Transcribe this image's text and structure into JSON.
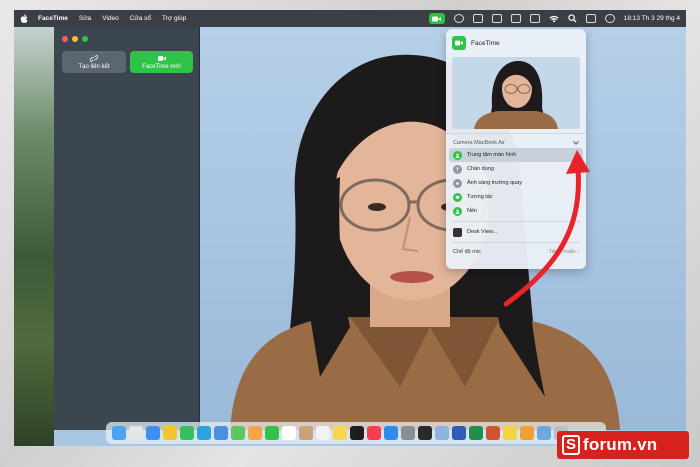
{
  "menubar": {
    "app": "FaceTime",
    "items": [
      "Sửa",
      "Video",
      "Cửa sổ",
      "Trợ giúp"
    ],
    "clock": "18:13 Th 3 29 thg 4"
  },
  "sidebar": {
    "link_button": "Tạo liên kết",
    "new_button": "FaceTime mới"
  },
  "dropdown": {
    "title": "FaceTime",
    "section": "Camera MacBook Air",
    "items": [
      {
        "label": "Trung tâm màn hình",
        "icon": "person-icon"
      },
      {
        "label": "Chân dung",
        "icon": "portrait-icon"
      },
      {
        "label": "Ánh sáng trường quay",
        "icon": "studio-light-icon"
      },
      {
        "label": "Tương tác",
        "icon": "reactions-icon"
      },
      {
        "label": "Nền",
        "icon": "background-icon"
      }
    ],
    "desk_view": "Desk View...",
    "mic_label": "Chế độ mic",
    "mic_value": "Tiêu chuẩn"
  },
  "brand": {
    "logo_letter": "S",
    "name": "forum.vn"
  },
  "colors": {
    "facetime_green": "#2fc447",
    "menubar": "#3a3f45",
    "sidebar": "#3b4650",
    "arrow": "#e8242a",
    "brand_red": "#d7211d"
  },
  "dock_icons": [
    "finder-icon",
    "launchpad-icon",
    "safari-icon",
    "chrome-icon",
    "messages-icon",
    "telegram-icon",
    "mail-icon",
    "maps-icon",
    "photos-icon",
    "facetime-icon",
    "calendar-icon",
    "contacts-icon",
    "reminders-icon",
    "notes-icon",
    "appletv-icon",
    "music-icon",
    "appstore-icon",
    "settings-icon",
    "terminal-icon",
    "preview-icon",
    "word-icon",
    "excel-icon",
    "powerpoint-icon",
    "stickies-icon",
    "pages-icon",
    "downloads-icon",
    "trash-icon"
  ]
}
